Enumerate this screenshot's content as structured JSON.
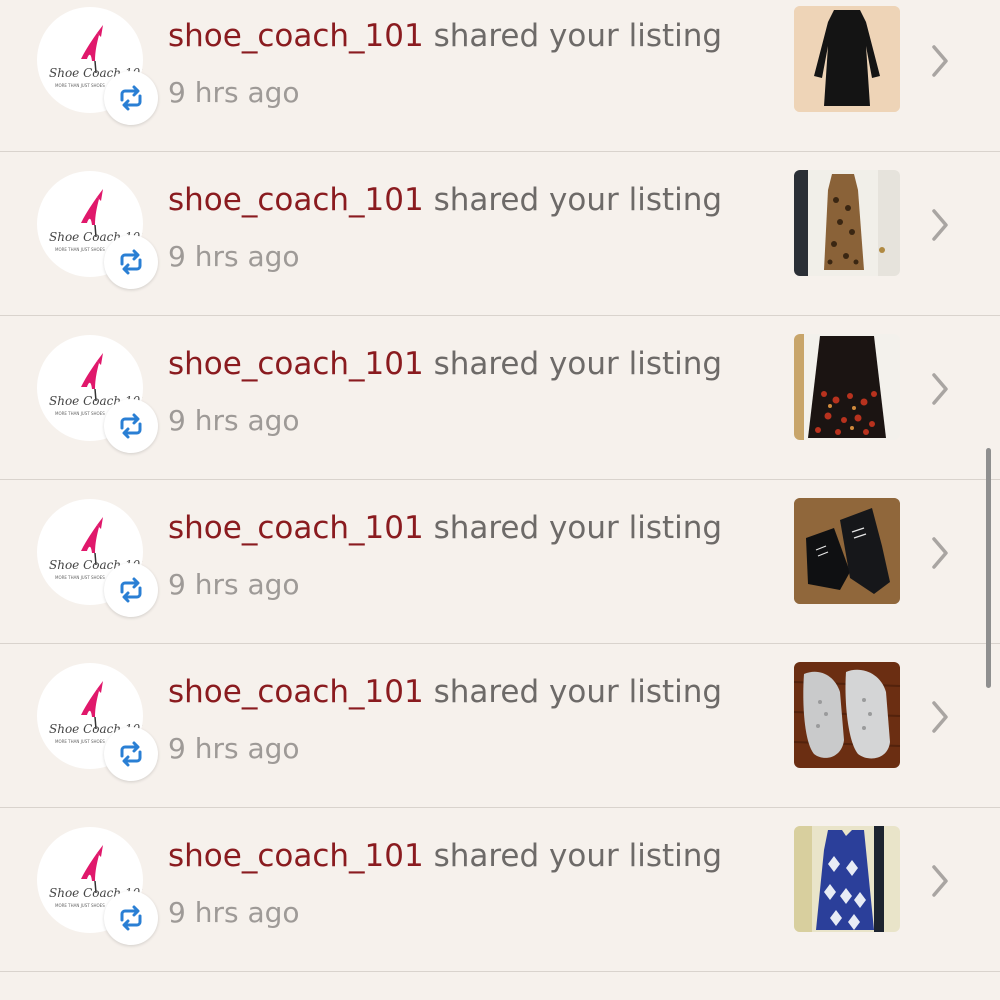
{
  "notifications": [
    {
      "username": "shoe_coach_101",
      "action": "shared your listing",
      "time": "9 hrs ago",
      "listing_icon": "black-dress"
    },
    {
      "username": "shoe_coach_101",
      "action": "shared your listing",
      "time": "9 hrs ago",
      "listing_icon": "leopard-maxi-dress"
    },
    {
      "username": "shoe_coach_101",
      "action": "shared your listing",
      "time": "9 hrs ago",
      "listing_icon": "embroidered-skirt"
    },
    {
      "username": "shoe_coach_101",
      "action": "shared your listing",
      "time": "9 hrs ago",
      "listing_icon": "black-ankle-boots"
    },
    {
      "username": "shoe_coach_101",
      "action": "shared your listing",
      "time": "9 hrs ago",
      "listing_icon": "gray-sneakers"
    },
    {
      "username": "shoe_coach_101",
      "action": "shared your listing",
      "time": "9 hrs ago",
      "listing_icon": "blue-print-dress"
    }
  ],
  "avatar": {
    "brand_text": "Shoe Coach 101",
    "tagline": "MORE THAN JUST SHOES",
    "icon": "pink-high-heel-logo"
  },
  "colors": {
    "background": "#f6f1ec",
    "username": "#8a1b1f",
    "action": "#6d6a68",
    "time": "#9e9a97",
    "share_icon": "#2a7fd4"
  }
}
